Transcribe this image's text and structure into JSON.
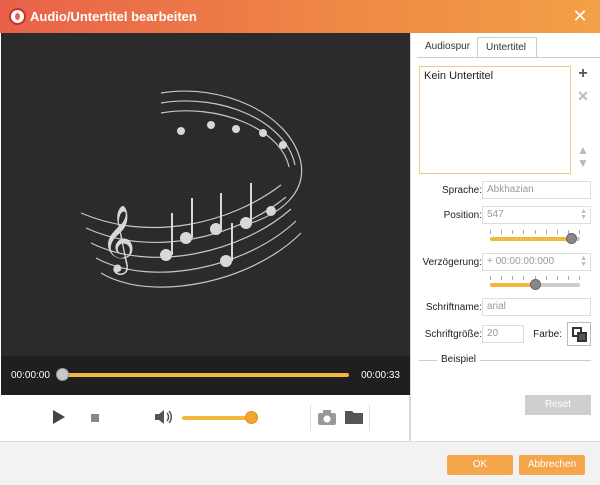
{
  "window": {
    "title": "Audio/Untertitel bearbeiten",
    "close_icon": "close-icon",
    "accent": "#f3a64b"
  },
  "player": {
    "time_current": "00:00:00",
    "time_total": "00:00:33",
    "progress_fraction": 0.02,
    "volume_fraction": 0.95,
    "icons": [
      "play-icon",
      "stop-icon",
      "speaker-icon",
      "camera-icon",
      "folder-icon"
    ]
  },
  "tabs": {
    "audio": "Audiospur",
    "subtitle": "Untertitel"
  },
  "subtitle_list": {
    "items": [
      "Kein Untertitel"
    ],
    "icons": [
      "plus-icon",
      "delete-icon",
      "arrow-up-icon",
      "arrow-down-icon"
    ]
  },
  "form": {
    "language_label": "Sprache:",
    "language_value": "Abkhazian",
    "position_label": "Position:",
    "position_value": "547",
    "position_fraction": 0.9,
    "delay_label": "Verzögerung:",
    "delay_value": "+ 00:00:00:000",
    "delay_fraction": 0.5,
    "font_name_label": "Schriftname:",
    "font_name_value": "arial",
    "font_size_label": "Schriftgröße:",
    "font_size_value": "20",
    "color_label": "Farbe:",
    "preview_label": "Beispiel",
    "reset_label": "Reset"
  },
  "footer": {
    "ok": "OK",
    "cancel": "Abbrechen"
  }
}
